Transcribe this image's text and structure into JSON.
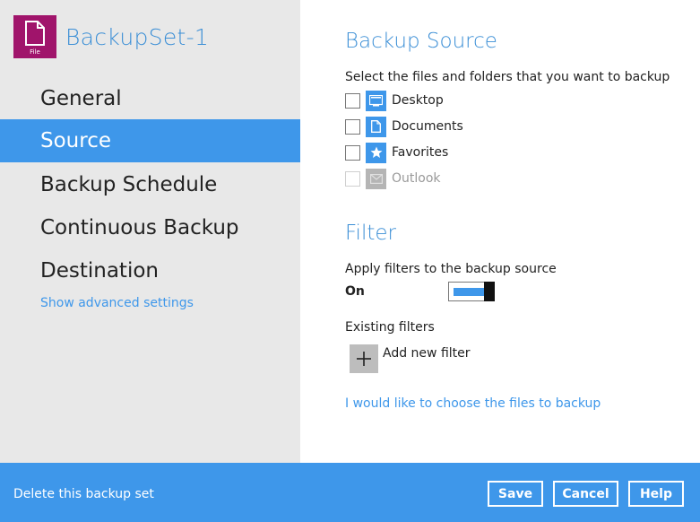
{
  "app": {
    "icon_label": "File",
    "title": "BackupSet-1"
  },
  "sidebar": {
    "items": [
      {
        "label": "General"
      },
      {
        "label": "Source"
      },
      {
        "label": "Backup Schedule"
      },
      {
        "label": "Continuous Backup"
      },
      {
        "label": "Destination"
      }
    ],
    "active_item": "Source",
    "advanced_link": "Show advanced settings"
  },
  "backup_source": {
    "title": "Backup Source",
    "instruction": "Select the files and folders that you want to backup",
    "items": [
      {
        "label": "Desktop",
        "icon": "desktop-icon",
        "checked": false,
        "enabled": true
      },
      {
        "label": "Documents",
        "icon": "document-icon",
        "checked": false,
        "enabled": true
      },
      {
        "label": "Favorites",
        "icon": "star-icon",
        "checked": false,
        "enabled": true
      },
      {
        "label": "Outlook",
        "icon": "envelope-icon",
        "checked": false,
        "enabled": false
      }
    ]
  },
  "filter": {
    "title": "Filter",
    "apply_label": "Apply filters to the backup source",
    "toggle_state": "On",
    "existing_label": "Existing filters",
    "add_label": "Add new filter"
  },
  "choose_files_link": "I would like to choose the files to backup",
  "footer": {
    "delete_label": "Delete this backup set",
    "save_label": "Save",
    "cancel_label": "Cancel",
    "help_label": "Help"
  },
  "colors": {
    "accent": "#3e97ea",
    "app_icon": "#a0146b",
    "sidebar_bg": "#e8e8e8"
  }
}
